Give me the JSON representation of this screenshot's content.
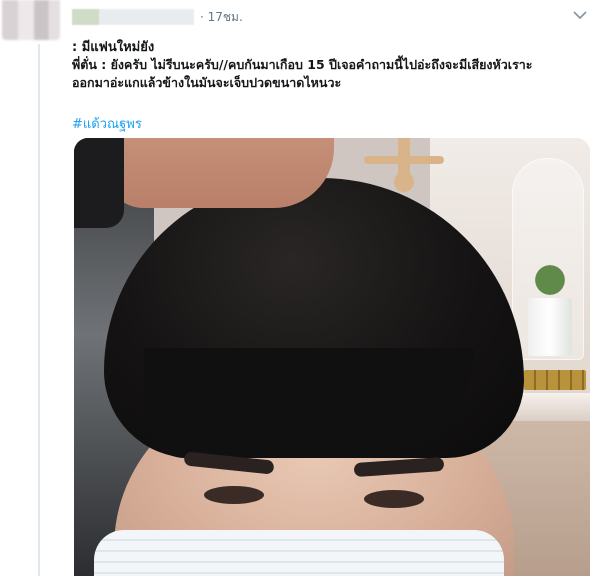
{
  "tweet": {
    "timestamp": "· 17ชม.",
    "lines": [
      ": มีแฟนใหม่ยัง",
      "พี่ตั่น : ยังครับ ไม่รีบนะครับ//คบกันมาเกือบ 15 ปีเจอคำถามนี้ไปอ่ะถึงจะมีเสียงหัวเราะ",
      "ออกมาอ่ะแกแล้วข้างในมันจะเจ็บปวดขนาดไหนวะ"
    ],
    "hashtag": "#แด้วณฐพร"
  },
  "icons": {
    "menu": "chevron-down-icon"
  }
}
